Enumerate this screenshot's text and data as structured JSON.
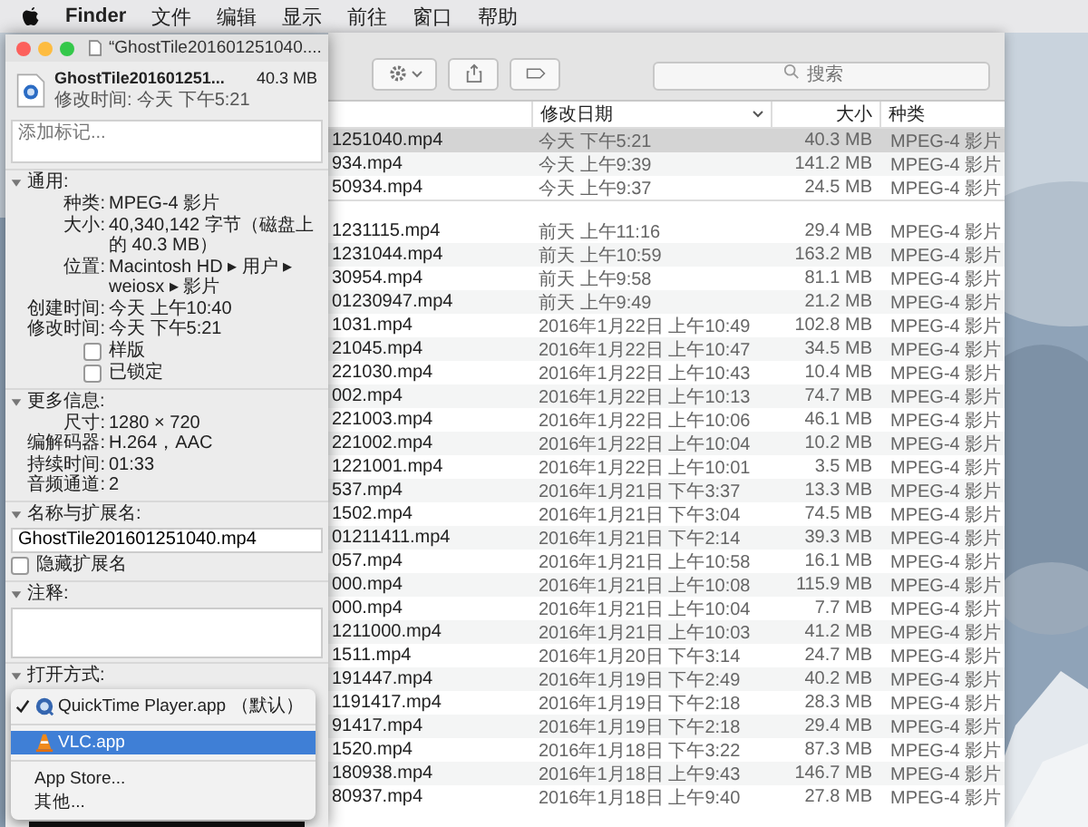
{
  "menu_bar": {
    "items": [
      "Finder",
      "文件",
      "编辑",
      "显示",
      "前往",
      "窗口",
      "帮助"
    ]
  },
  "finder": {
    "search": {
      "placeholder": "搜索"
    },
    "columns": [
      {
        "label": "修改日期",
        "sorted": true
      },
      {
        "label": "大小",
        "sorted": false
      },
      {
        "label": "种类",
        "sorted": false
      }
    ],
    "groups": [
      {
        "rows": [
          {
            "name": "1251040.mp4",
            "modified": "今天 下午5:21",
            "size": "40.3 MB",
            "kind": "MPEG-4 影片",
            "selected": true
          },
          {
            "name": "934.mp4",
            "modified": "今天 上午9:39",
            "size": "141.2 MB",
            "kind": "MPEG-4 影片",
            "selected": false
          },
          {
            "name": "50934.mp4",
            "modified": "今天 上午9:37",
            "size": "24.5 MB",
            "kind": "MPEG-4 影片",
            "selected": false
          }
        ]
      },
      {
        "rows": [
          {
            "name": "1231115.mp4",
            "modified": "前天 上午11:16",
            "size": "29.4 MB",
            "kind": "MPEG-4 影片",
            "selected": false
          },
          {
            "name": "1231044.mp4",
            "modified": "前天 上午10:59",
            "size": "163.2 MB",
            "kind": "MPEG-4 影片",
            "selected": false
          },
          {
            "name": "30954.mp4",
            "modified": "前天 上午9:58",
            "size": "81.1 MB",
            "kind": "MPEG-4 影片",
            "selected": false
          },
          {
            "name": "01230947.mp4",
            "modified": "前天 上午9:49",
            "size": "21.2 MB",
            "kind": "MPEG-4 影片",
            "selected": false
          },
          {
            "name": "1031.mp4",
            "modified": "2016年1月22日 上午10:49",
            "size": "102.8 MB",
            "kind": "MPEG-4 影片",
            "selected": false
          },
          {
            "name": "21045.mp4",
            "modified": "2016年1月22日 上午10:47",
            "size": "34.5 MB",
            "kind": "MPEG-4 影片",
            "selected": false
          },
          {
            "name": "221030.mp4",
            "modified": "2016年1月22日 上午10:43",
            "size": "10.4 MB",
            "kind": "MPEG-4 影片",
            "selected": false
          },
          {
            "name": "002.mp4",
            "modified": "2016年1月22日 上午10:13",
            "size": "74.7 MB",
            "kind": "MPEG-4 影片",
            "selected": false
          },
          {
            "name": "221003.mp4",
            "modified": "2016年1月22日 上午10:06",
            "size": "46.1 MB",
            "kind": "MPEG-4 影片",
            "selected": false
          },
          {
            "name": "221002.mp4",
            "modified": "2016年1月22日 上午10:04",
            "size": "10.2 MB",
            "kind": "MPEG-4 影片",
            "selected": false
          },
          {
            "name": "1221001.mp4",
            "modified": "2016年1月22日 上午10:01",
            "size": "3.5 MB",
            "kind": "MPEG-4 影片",
            "selected": false
          },
          {
            "name": "537.mp4",
            "modified": "2016年1月21日 下午3:37",
            "size": "13.3 MB",
            "kind": "MPEG-4 影片",
            "selected": false
          },
          {
            "name": "1502.mp4",
            "modified": "2016年1月21日 下午3:04",
            "size": "74.5 MB",
            "kind": "MPEG-4 影片",
            "selected": false
          },
          {
            "name": "01211411.mp4",
            "modified": "2016年1月21日 下午2:14",
            "size": "39.3 MB",
            "kind": "MPEG-4 影片",
            "selected": false
          },
          {
            "name": "057.mp4",
            "modified": "2016年1月21日 上午10:58",
            "size": "16.1 MB",
            "kind": "MPEG-4 影片",
            "selected": false
          },
          {
            "name": "000.mp4",
            "modified": "2016年1月21日 上午10:08",
            "size": "115.9 MB",
            "kind": "MPEG-4 影片",
            "selected": false
          },
          {
            "name": "000.mp4",
            "modified": "2016年1月21日 上午10:04",
            "size": "7.7 MB",
            "kind": "MPEG-4 影片",
            "selected": false
          },
          {
            "name": "1211000.mp4",
            "modified": "2016年1月21日 上午10:03",
            "size": "41.2 MB",
            "kind": "MPEG-4 影片",
            "selected": false
          },
          {
            "name": "1511.mp4",
            "modified": "2016年1月20日 下午3:14",
            "size": "24.7 MB",
            "kind": "MPEG-4 影片",
            "selected": false
          },
          {
            "name": "191447.mp4",
            "modified": "2016年1月19日 下午2:49",
            "size": "40.2 MB",
            "kind": "MPEG-4 影片",
            "selected": false
          },
          {
            "name": "1191417.mp4",
            "modified": "2016年1月19日 下午2:18",
            "size": "28.3 MB",
            "kind": "MPEG-4 影片",
            "selected": false
          },
          {
            "name": "91417.mp4",
            "modified": "2016年1月19日 下午2:18",
            "size": "29.4 MB",
            "kind": "MPEG-4 影片",
            "selected": false
          },
          {
            "name": "1520.mp4",
            "modified": "2016年1月18日 下午3:22",
            "size": "87.3 MB",
            "kind": "MPEG-4 影片",
            "selected": false
          },
          {
            "name": "180938.mp4",
            "modified": "2016年1月18日 上午9:43",
            "size": "146.7 MB",
            "kind": "MPEG-4 影片",
            "selected": false
          },
          {
            "name": "80937.mp4",
            "modified": "2016年1月18日 上午9:40",
            "size": "27.8 MB",
            "kind": "MPEG-4 影片",
            "selected": false
          }
        ]
      }
    ]
  },
  "info_window": {
    "title": "“GhostTile201601251040....",
    "file_name": "GhostTile201601251...",
    "file_size": "40.3 MB",
    "modified": "修改时间: 今天 下午5:21",
    "tags": {
      "placeholder": "添加标记..."
    },
    "sections": [
      {
        "kind": "props",
        "title": "通用:",
        "expanded": true,
        "rows": [
          {
            "label": "种类:",
            "value": "MPEG-4 影片"
          },
          {
            "label": "大小:",
            "value": "40,340,142 字节（磁盘上的 40.3 MB）"
          },
          {
            "label": "位置:",
            "value": "Macintosh HD ▸ 用户 ▸ weiosx ▸ 影片"
          },
          {
            "label": "创建时间:",
            "value": "今天 上午10:40"
          },
          {
            "label": "修改时间:",
            "value": "今天 下午5:21"
          }
        ],
        "checkboxes": [
          {
            "label": "样版",
            "checked": false
          },
          {
            "label": "已锁定",
            "checked": false
          }
        ]
      },
      {
        "kind": "props",
        "title": "更多信息:",
        "expanded": true,
        "rows": [
          {
            "label": "尺寸:",
            "value": "1280 × 720"
          },
          {
            "label": "编解码器:",
            "value": "H.264，AAC"
          },
          {
            "label": "持续时间:",
            "value": "01:33"
          },
          {
            "label": "音频通道:",
            "value": "2"
          }
        ]
      },
      {
        "kind": "name",
        "title": "名称与扩展名:",
        "expanded": true,
        "value": "GhostTile201601251040.mp4",
        "checkboxes": [
          {
            "label": "隐藏扩展名",
            "checked": false
          }
        ]
      },
      {
        "kind": "comments",
        "title": "注释:",
        "expanded": true
      },
      {
        "kind": "open_with",
        "title": "打开方式:",
        "expanded": true,
        "menu": [
          {
            "kind": "app",
            "label": "QuickTime Player.app",
            "note": "（默认）",
            "checked": true,
            "selected": false
          },
          {
            "kind": "separator"
          },
          {
            "kind": "app",
            "label": "VLC.app",
            "checked": false,
            "selected": true
          },
          {
            "kind": "separator"
          },
          {
            "kind": "item",
            "label": "App Store...",
            "selected": false
          },
          {
            "kind": "item",
            "label": "其他...",
            "selected": false
          }
        ]
      }
    ]
  }
}
